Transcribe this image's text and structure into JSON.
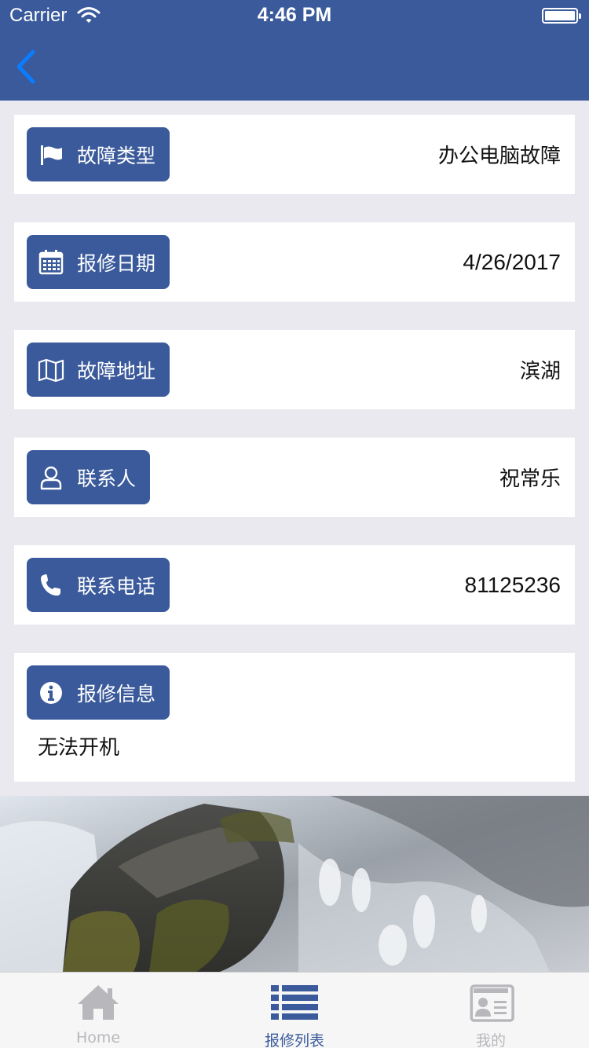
{
  "status_bar": {
    "carrier": "Carrier",
    "time": "4:46 PM"
  },
  "colors": {
    "nav": "#3a5a9b",
    "badge": "#3a5a9b",
    "back_arrow": "#0a7cff",
    "tab_inactive": "#b8b8bc"
  },
  "nav": {
    "back_icon": "chevron-left-icon"
  },
  "fields": [
    {
      "icon": "flag-icon",
      "label": "故障类型",
      "value": "办公电脑故障"
    },
    {
      "icon": "calendar-icon",
      "label": "报修日期",
      "value": "4/26/2017"
    },
    {
      "icon": "map-icon",
      "label": "故障地址",
      "value": "滨湖"
    },
    {
      "icon": "user-icon",
      "label": "联系人",
      "value": "祝常乐"
    },
    {
      "icon": "phone-icon",
      "label": "联系电话",
      "value": "81125236"
    }
  ],
  "info": {
    "icon": "info-icon",
    "label": "报修信息",
    "text": "无法开机"
  },
  "tabs": [
    {
      "icon": "home-icon",
      "label": "Home",
      "active": false
    },
    {
      "icon": "list-icon",
      "label": "报修列表",
      "active": true
    },
    {
      "icon": "id-card-icon",
      "label": "我的",
      "active": false
    }
  ]
}
